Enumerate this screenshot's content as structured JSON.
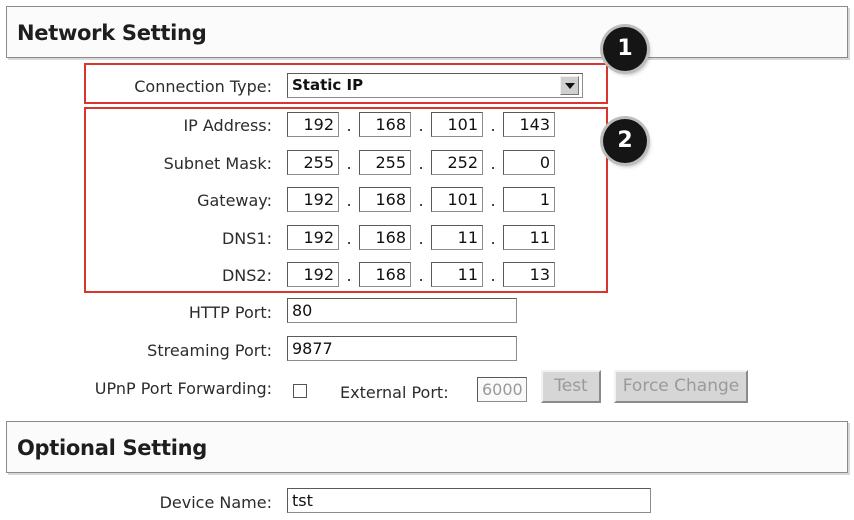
{
  "network_section": {
    "title": "Network Setting"
  },
  "connection_type": {
    "label": "Connection Type:",
    "value": "Static IP"
  },
  "ip_rows": [
    {
      "label": "IP Address:",
      "octets": [
        "192",
        "168",
        "101",
        "143"
      ]
    },
    {
      "label": "Subnet Mask:",
      "octets": [
        "255",
        "255",
        "252",
        "0"
      ]
    },
    {
      "label": "Gateway:",
      "octets": [
        "192",
        "168",
        "101",
        "1"
      ]
    },
    {
      "label": "DNS1:",
      "octets": [
        "192",
        "168",
        "11",
        "11"
      ]
    },
    {
      "label": "DNS2:",
      "octets": [
        "192",
        "168",
        "11",
        "13"
      ]
    }
  ],
  "dot": ".",
  "http_port": {
    "label": "HTTP Port:",
    "value": "80"
  },
  "streaming_port": {
    "label": "Streaming Port:",
    "value": "9877"
  },
  "upnp": {
    "label": "UPnP Port Forwarding:",
    "checked": false,
    "external_label": "External Port:",
    "external_value": "6000",
    "test_label": "Test",
    "force_label": "Force Change"
  },
  "optional_section": {
    "title": "Optional Setting"
  },
  "device_name": {
    "label": "Device Name:",
    "value": "tst"
  },
  "callouts": {
    "one": "1",
    "two": "2"
  },
  "colors": {
    "highlight_border": "#d8362c",
    "badge_bg": "#151515"
  }
}
